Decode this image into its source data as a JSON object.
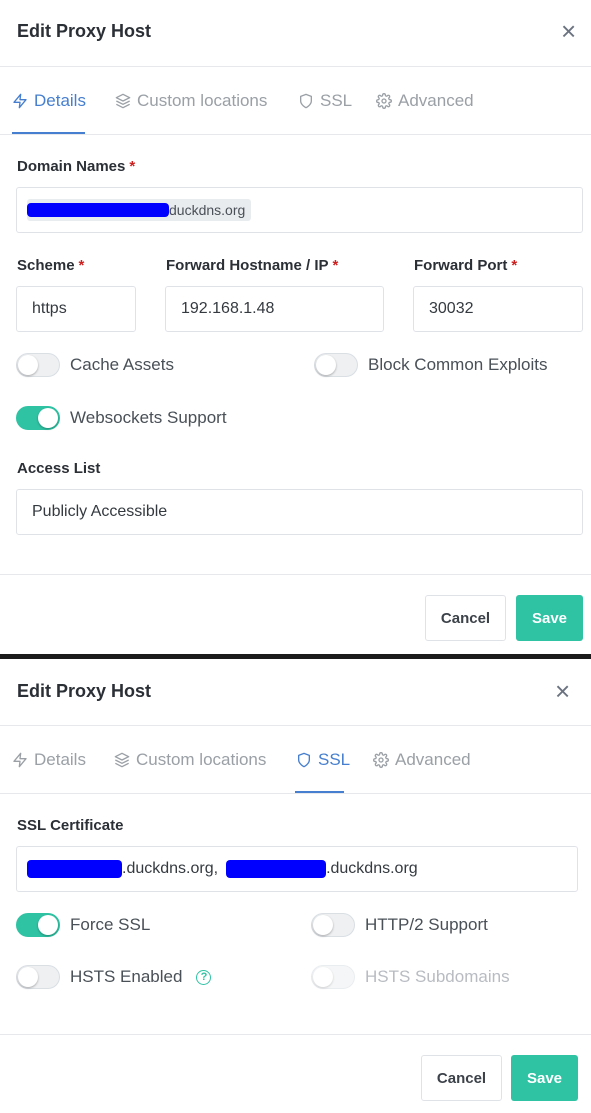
{
  "colors": {
    "accent": "#467fcf",
    "success": "#2fc3a4",
    "required": "#cd201f",
    "redaction": "#0000ff"
  },
  "panel1": {
    "title": "Edit Proxy Host",
    "close_glyph": "×",
    "tabs": [
      {
        "label": "Details",
        "icon": "bolt-icon",
        "active": true
      },
      {
        "label": "Custom locations",
        "icon": "layers-icon",
        "active": false
      },
      {
        "label": "SSL",
        "icon": "shield-icon",
        "active": false
      },
      {
        "label": "Advanced",
        "icon": "gear-icon",
        "active": false
      }
    ],
    "domain_names": {
      "label": "Domain Names",
      "required": "*",
      "chip_suffix": "duckdns.org"
    },
    "scheme": {
      "label": "Scheme",
      "required": "*",
      "value": "https"
    },
    "forward_host": {
      "label": "Forward Hostname / IP",
      "required": "*",
      "value": "192.168.1.48"
    },
    "forward_port": {
      "label": "Forward Port",
      "required": "*",
      "value": "30032"
    },
    "toggles": [
      {
        "label": "Cache Assets",
        "on": false
      },
      {
        "label": "Block Common Exploits",
        "on": false
      },
      {
        "label": "Websockets Support",
        "on": true
      }
    ],
    "access_list": {
      "label": "Access List",
      "value": "Publicly Accessible"
    },
    "cancel": "Cancel",
    "save": "Save"
  },
  "panel2": {
    "title": "Edit Proxy Host",
    "close_glyph": "×",
    "tabs": [
      {
        "label": "Details",
        "icon": "bolt-icon",
        "active": false
      },
      {
        "label": "Custom locations",
        "icon": "layers-icon",
        "active": false
      },
      {
        "label": "SSL",
        "icon": "shield-icon",
        "active": true
      },
      {
        "label": "Advanced",
        "icon": "gear-icon",
        "active": false
      }
    ],
    "ssl_certificate": {
      "label": "SSL Certificate",
      "part1": ".duckdns.org,",
      "part2": ".duckdns.org"
    },
    "toggles": [
      {
        "label": "Force SSL",
        "on": true
      },
      {
        "label": "HTTP/2 Support",
        "on": false
      },
      {
        "label": "HSTS Enabled",
        "on": false,
        "help": "?"
      },
      {
        "label": "HSTS Subdomains",
        "on": false,
        "disabled": true
      }
    ],
    "cancel": "Cancel",
    "save": "Save"
  }
}
